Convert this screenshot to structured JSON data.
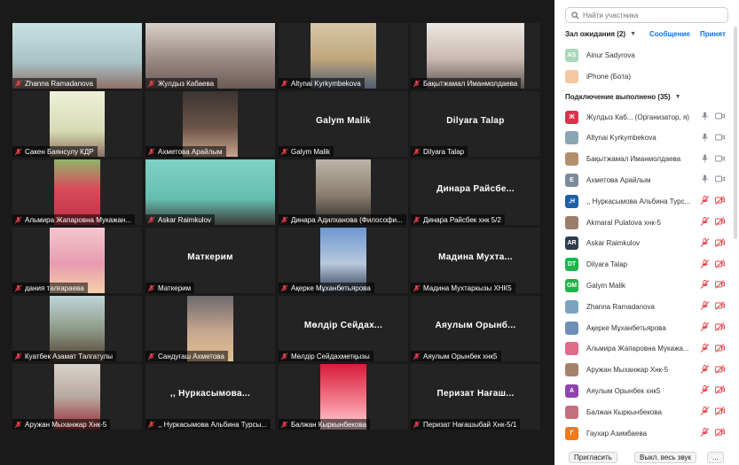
{
  "gallery": {
    "tiles": [
      {
        "caption": "Zhanna Ramadanova",
        "big": ""
      },
      {
        "caption": "Жулдыз Кабаева",
        "big": ""
      },
      {
        "caption": "Altynai Kyrkymbekova",
        "big": ""
      },
      {
        "caption": "Бақытжамал Иманмолдаева",
        "big": ""
      },
      {
        "caption": "Сакен Баянсулу КДР",
        "big": ""
      },
      {
        "caption": "Ахметова Арайлым",
        "big": ""
      },
      {
        "caption": "Galym Malik",
        "big": "Galym Malik"
      },
      {
        "caption": "Dilyara Talap",
        "big": "Dilyara Talap"
      },
      {
        "caption": "Альмира Жапаровна Мукажан...",
        "big": ""
      },
      {
        "caption": "Askar Raimkulov",
        "big": ""
      },
      {
        "caption": "Динара Адилханова (Философи...",
        "big": ""
      },
      {
        "caption": "Динара Райсбек хнк 5/2",
        "big": "Динара Райсбе..."
      },
      {
        "caption": "дания тәлғараева",
        "big": ""
      },
      {
        "caption": "Маткерим",
        "big": "Маткерим"
      },
      {
        "caption": "Ақерке Мұханбетьярова",
        "big": ""
      },
      {
        "caption": "Мадина Мухтаркызы ХНК5",
        "big": "Мадина Мухта..."
      },
      {
        "caption": "Куатбек Азамат Талгатулы",
        "big": ""
      },
      {
        "caption": "Сандугаш Ахметова",
        "big": ""
      },
      {
        "caption": "Мөлдір Сейдахметқызы",
        "big": "Мөлдір Сейдах..."
      },
      {
        "caption": "Аяулым Орынбек хнк5",
        "big": "Аяулым Орынб..."
      },
      {
        "caption": "Аружан Мыханжар Хнк-5",
        "big": ""
      },
      {
        "caption": ",, Нуркасымова Альбина Турсы...",
        "big": ",, Нуркасымова..."
      },
      {
        "caption": "Балжан Кыркынбекова",
        "big": ""
      },
      {
        "caption": "Перизат Нағашыбай Хнк-5/1",
        "big": "Перизат Нағаш..."
      }
    ]
  },
  "panel": {
    "search_placeholder": "Найти участника",
    "waiting_title": "Зал ожидания (2)",
    "message_label": "Сообщение",
    "admit_label": "Принят",
    "waiting": [
      {
        "initials": "AS",
        "color": "#a8d8b9",
        "name": "Ainur Sadyrova"
      },
      {
        "initials": "",
        "color": "#f4c7a1",
        "name": "iPhone (Бота)"
      }
    ],
    "connected_title": "Подключение выполнено (35)",
    "participants": [
      {
        "initials": "Ж",
        "color": "#e0314b",
        "name": "Жулдыз Каб...  (Организатор, я)"
      },
      {
        "initials": "",
        "color": "#8aa6b5",
        "name": "Altynai Kyrkymbekova"
      },
      {
        "initials": "",
        "color": "#b48e6b",
        "name": "Бақытжамал Иманмолдаева"
      },
      {
        "initials": "Е",
        "color": "#7d8a99",
        "name": "Ахметова Арайлым"
      },
      {
        "initials": ",Н",
        "color": "#1f5fa8",
        "name": ",, Нуркасымова Альбина Турс..."
      },
      {
        "initials": "",
        "color": "#9c7d6a",
        "name": "Akmaral Pulatova хнк-5"
      },
      {
        "initials": "AR",
        "color": "#2f3c4f",
        "name": "Askar Raimkulov"
      },
      {
        "initials": "DT",
        "color": "#1fb54a",
        "name": "Dilyara Talap"
      },
      {
        "initials": "GM",
        "color": "#1fb54a",
        "name": "Galym Malik"
      },
      {
        "initials": "",
        "color": "#7aa4c0",
        "name": "Zhanna Ramadanova"
      },
      {
        "initials": "",
        "color": "#6e8fb8",
        "name": "Ақерке Мұханбетьярова"
      },
      {
        "initials": "",
        "color": "#e06b8a",
        "name": "Альмира Жапаровна Мукажа..."
      },
      {
        "initials": "",
        "color": "#a5836b",
        "name": "Аружан Мыханжар Хнк-5"
      },
      {
        "initials": "А",
        "color": "#8e44ad",
        "name": "Аяулым Орынбек хнк5"
      },
      {
        "initials": "",
        "color": "#c66f7d",
        "name": "Балжан Кыркынбекова"
      },
      {
        "initials": "Г",
        "color": "#f07a1c",
        "name": "Гаухар Азимбаева"
      }
    ],
    "invite_label": "Пригласить",
    "mute_all_label": "Выкл. весь звук",
    "more_label": "..."
  }
}
